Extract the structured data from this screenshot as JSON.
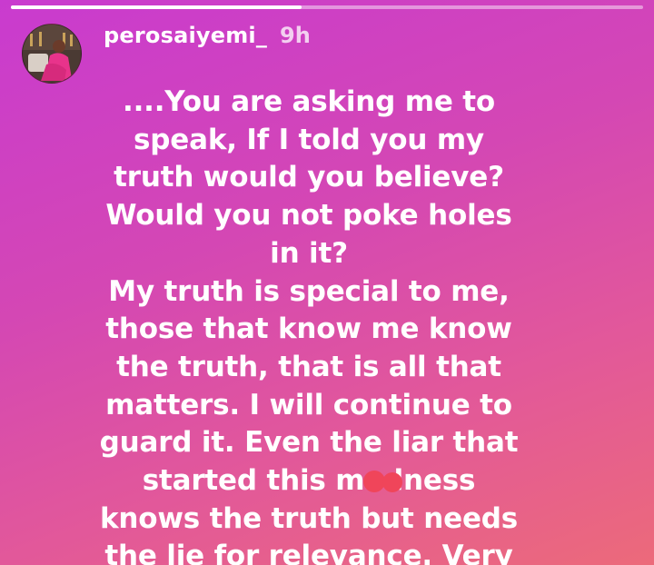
{
  "story": {
    "progress": 0.46,
    "username": "perosaiyemi_",
    "time_ago": "9h",
    "text": "....You are asking me to\nspeak, If I told you my\ntruth would you believe?\nWould you not poke holes\nin it?\nMy truth is special to me,\nthose that know me know\nthe truth, that is all that\nmatters. I will continue to\nguard it. Even the liar that\nstarted this madness\nknows the truth but needs\nthe lie for relevance. Very",
    "sticker_icon": "red-dots-sticker-icon"
  },
  "colors": {
    "background_top": "#c93bcf",
    "background_bottom": "#ec6a7a",
    "text": "#ffffff",
    "sticker": "#f0455a"
  }
}
